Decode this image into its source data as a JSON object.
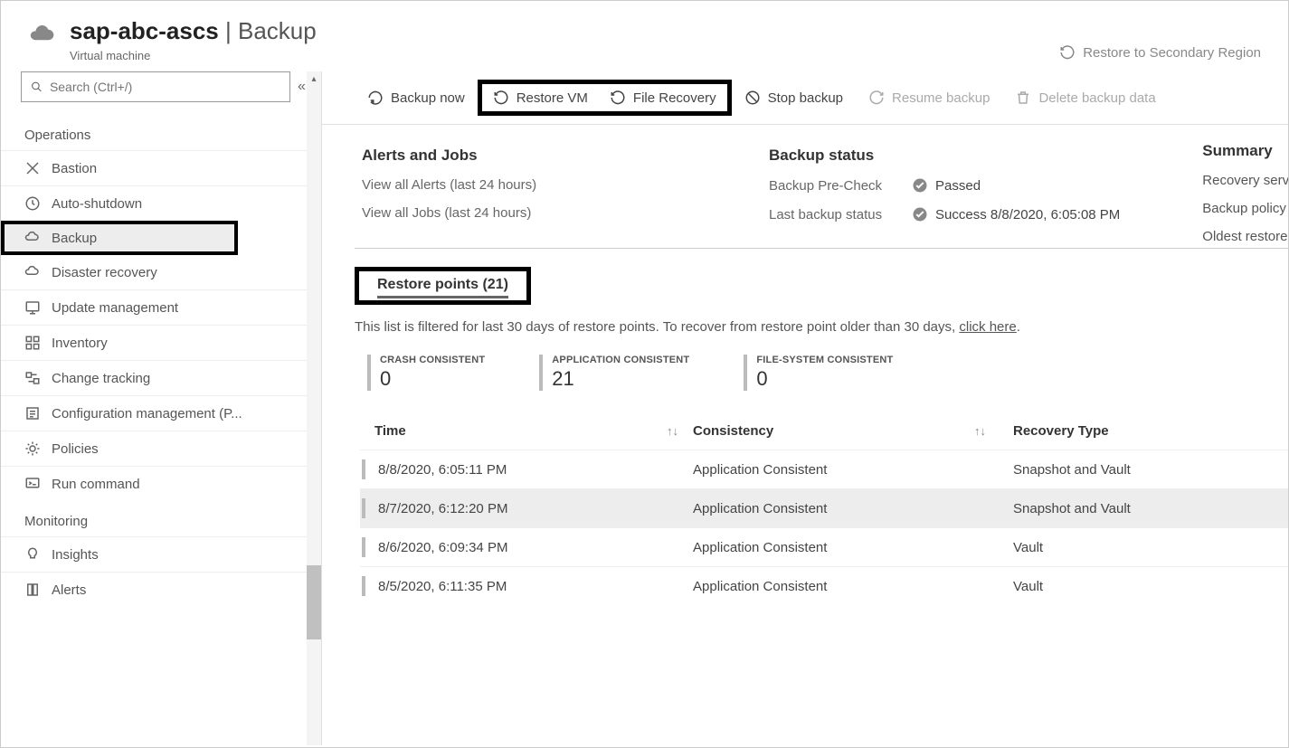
{
  "header": {
    "resource_name": "sap-abc-ascs",
    "page_name": "Backup",
    "resource_type": "Virtual machine",
    "restore_secondary": "Restore to Secondary Region"
  },
  "search": {
    "placeholder": "Search (Ctrl+/)"
  },
  "sidebar": {
    "sections": [
      {
        "label": "Operations",
        "items": [
          {
            "label": "Bastion",
            "icon": "bastion"
          },
          {
            "label": "Auto-shutdown",
            "icon": "clock"
          },
          {
            "label": "Backup",
            "icon": "backup",
            "active": true,
            "highlighted": true
          },
          {
            "label": "Disaster recovery",
            "icon": "recovery"
          },
          {
            "label": "Update management",
            "icon": "update"
          },
          {
            "label": "Inventory",
            "icon": "inventory"
          },
          {
            "label": "Change tracking",
            "icon": "tracking"
          },
          {
            "label": "Configuration management (P...",
            "icon": "config"
          },
          {
            "label": "Policies",
            "icon": "policies"
          },
          {
            "label": "Run command",
            "icon": "run"
          }
        ]
      },
      {
        "label": "Monitoring",
        "items": [
          {
            "label": "Insights",
            "icon": "insights"
          },
          {
            "label": "Alerts",
            "icon": "alerts"
          }
        ]
      }
    ]
  },
  "toolbar": {
    "backup_now": "Backup now",
    "restore_vm": "Restore VM",
    "file_recovery": "File Recovery",
    "stop_backup": "Stop backup",
    "resume_backup": "Resume backup",
    "delete_backup": "Delete backup data"
  },
  "alerts_jobs": {
    "heading": "Alerts and Jobs",
    "view_alerts": "View all Alerts (last 24 hours)",
    "view_jobs": "View all Jobs (last 24 hours)"
  },
  "backup_status": {
    "heading": "Backup status",
    "precheck_label": "Backup Pre-Check",
    "precheck_value": "Passed",
    "last_label": "Last backup status",
    "last_value": "Success 8/8/2020, 6:05:08 PM"
  },
  "summary": {
    "heading": "Summary",
    "rows": [
      "Recovery servic",
      "Backup policy",
      "Oldest restore p"
    ]
  },
  "restore_points": {
    "tab_label": "Restore points (21)",
    "filter_text_a": "This list is filtered for last 30 days of restore points. To recover from restore point older than 30 days, ",
    "filter_link": "click here",
    "filter_text_b": ".",
    "consistency": [
      {
        "label": "CRASH CONSISTENT",
        "value": "0"
      },
      {
        "label": "APPLICATION CONSISTENT",
        "value": "21"
      },
      {
        "label": "FILE-SYSTEM CONSISTENT",
        "value": "0"
      }
    ],
    "columns": {
      "time": "Time",
      "consistency": "Consistency",
      "recovery": "Recovery Type"
    },
    "rows": [
      {
        "time": "8/8/2020, 6:05:11 PM",
        "consistency": "Application Consistent",
        "recovery": "Snapshot and Vault"
      },
      {
        "time": "8/7/2020, 6:12:20 PM",
        "consistency": "Application Consistent",
        "recovery": "Snapshot and Vault",
        "hover": true
      },
      {
        "time": "8/6/2020, 6:09:34 PM",
        "consistency": "Application Consistent",
        "recovery": "Vault"
      },
      {
        "time": "8/5/2020, 6:11:35 PM",
        "consistency": "Application Consistent",
        "recovery": "Vault"
      }
    ]
  }
}
